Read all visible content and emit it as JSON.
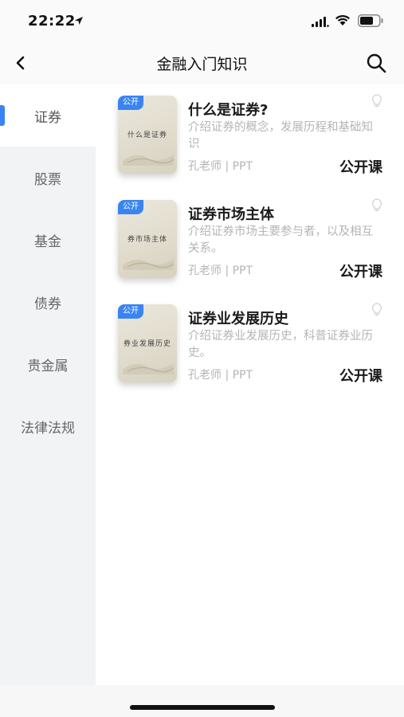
{
  "status_bar": {
    "time": "22:22"
  },
  "nav": {
    "title": "金融入门知识"
  },
  "sidebar": {
    "items": [
      {
        "label": "证券"
      },
      {
        "label": "股票"
      },
      {
        "label": "基金"
      },
      {
        "label": "债券"
      },
      {
        "label": "贵金属"
      },
      {
        "label": "法律法规"
      }
    ],
    "active_index": 0
  },
  "courses": [
    {
      "badge": "公开",
      "thumb_text": "什么是证券",
      "title": "什么是证券?",
      "desc": "介绍证券的概念，发展历程和基础知识",
      "meta": "孔老师 | PPT",
      "type": "公开课"
    },
    {
      "badge": "公开",
      "thumb_text": "券市场主体",
      "title": "证券市场主体",
      "desc": "介绍证券市场主要参与者，以及相互关系。",
      "meta": "孔老师 | PPT",
      "type": "公开课"
    },
    {
      "badge": "公开",
      "thumb_text": "券业发展历史",
      "title": "证券业发展历史",
      "desc": "介绍证券业发展历史，科普证券业历史。",
      "meta": "孔老师 | PPT",
      "type": "公开课"
    }
  ],
  "colors": {
    "accent": "#3a84f1",
    "sidebar_bg": "#f2f3f5",
    "muted_text": "#b5b5b5"
  }
}
